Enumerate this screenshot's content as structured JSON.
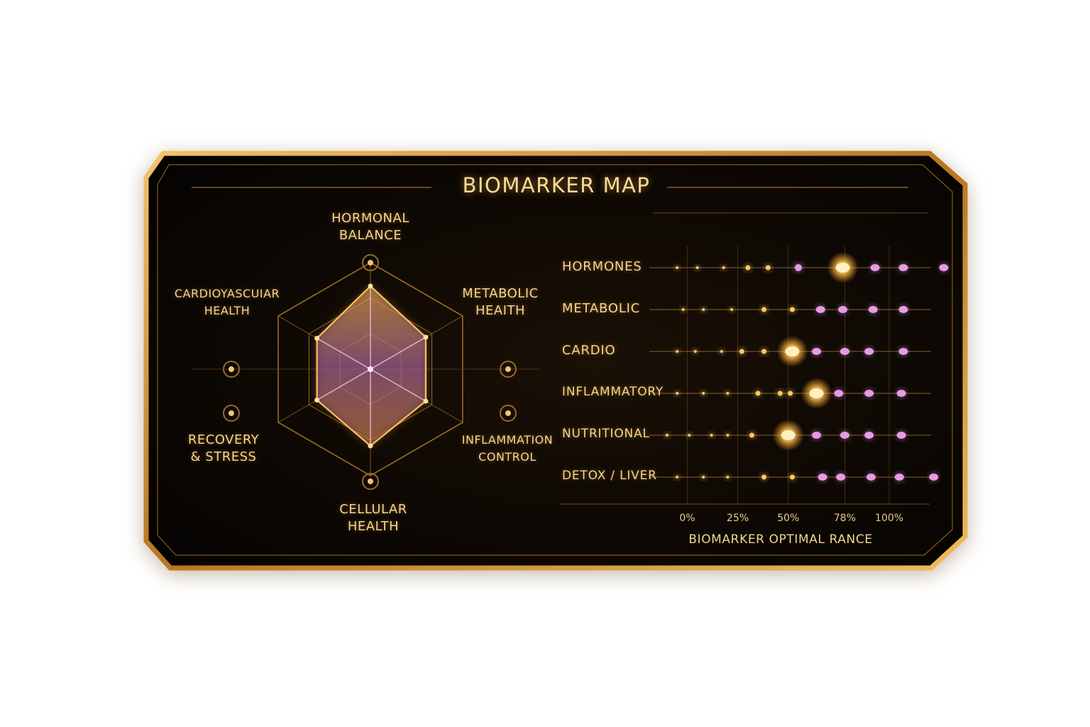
{
  "title": "BIOMARKER MAP",
  "colors": {
    "frame": "#d99a2e",
    "panel_bg": "#080503",
    "text": "#f3d58e",
    "glow_gold": "#ffc55a",
    "pink": "#e69be6",
    "radar_fill": "#8a4ea0"
  },
  "chart_data": [
    {
      "type": "radar",
      "axes": [
        {
          "lines": [
            "HORMONAL",
            "BALANCE"
          ]
        },
        {
          "lines": [
            "METABOLIC",
            "HEAITH"
          ]
        },
        {
          "lines": [
            "INFLAMMATION",
            "CONTROL"
          ]
        },
        {
          "lines": [
            "CELLULAR",
            "HEALTH"
          ]
        },
        {
          "lines": [
            "RECOVERY",
            "& STRESS"
          ]
        },
        {
          "lines": [
            "CARDIOYASCUIAR",
            "HEALTH"
          ]
        }
      ],
      "values": [
        0.78,
        0.6,
        0.6,
        0.72,
        0.58,
        0.58
      ],
      "range": [
        0,
        1
      ],
      "rings": 3,
      "grid": true
    },
    {
      "type": "scatter",
      "categories": [
        "HORMONES",
        "METABOLIC",
        "CARDIO",
        "INFLAMMATORY",
        "NUTRITIONAL",
        "DETOX / LIVER"
      ],
      "xticks": [
        "0%",
        "25%",
        "50%",
        "78%",
        "100%"
      ],
      "xtick_values": [
        0,
        25,
        50,
        78,
        100
      ],
      "xlabel": "BIOMARKER OPTIMAL RANCE",
      "xlim": [
        -10,
        120
      ],
      "rows": [
        {
          "points": [
            -5,
            5,
            18,
            30,
            40,
            55,
            77,
            93,
            107,
            127
          ],
          "highlight": 77
        },
        {
          "points": [
            -2,
            8,
            22,
            38,
            52,
            66,
            77,
            92,
            107
          ],
          "highlight": null
        },
        {
          "points": [
            -5,
            4,
            17,
            27,
            38,
            52,
            64,
            78,
            90,
            107
          ],
          "highlight": 52
        },
        {
          "points": [
            -5,
            8,
            20,
            35,
            46,
            51,
            64,
            75,
            90,
            106
          ],
          "highlight": 64
        },
        {
          "points": [
            -10,
            1,
            12,
            20,
            32,
            50,
            64,
            78,
            90,
            106
          ],
          "highlight": 50
        },
        {
          "points": [
            -5,
            8,
            20,
            38,
            52,
            67,
            76,
            91,
            105,
            122
          ],
          "highlight": null
        }
      ]
    }
  ]
}
